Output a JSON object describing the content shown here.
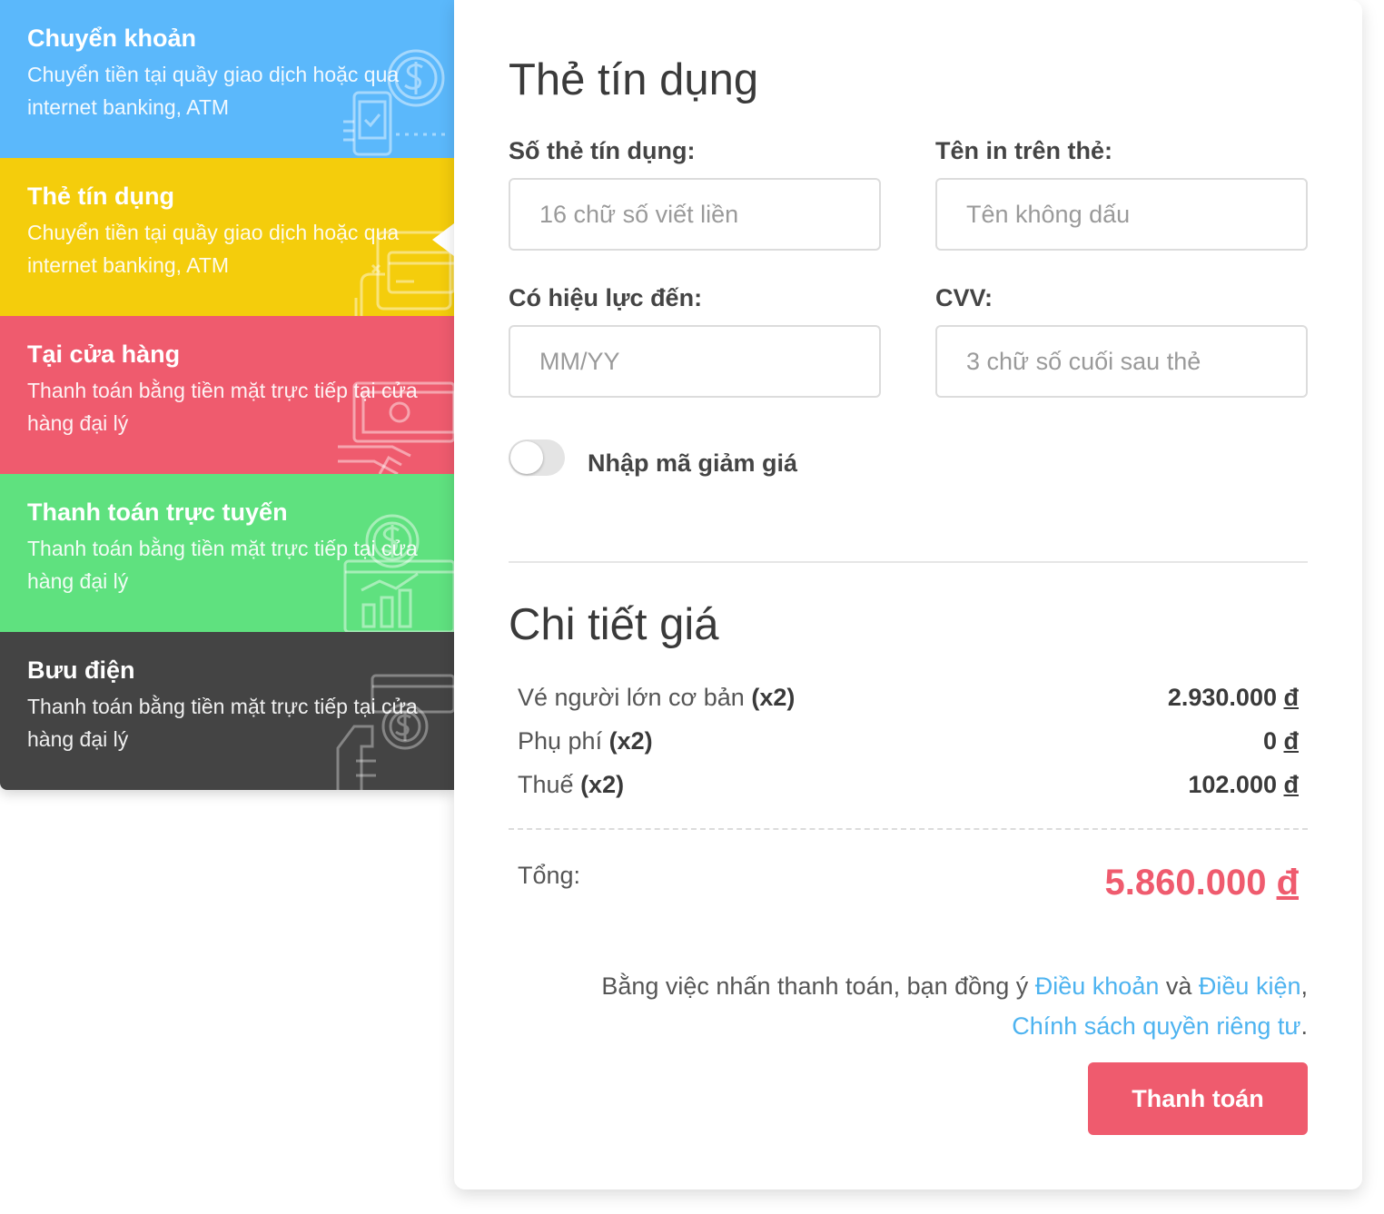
{
  "methods": [
    {
      "title": "Chuyển khoản",
      "desc": "Chuyển tiền tại quầy giao dịch hoặc qua internet banking, ATM",
      "color": "#5bb8fb",
      "icon": "mobile-banking-icon"
    },
    {
      "title": "Thẻ tín dụng",
      "desc": "Chuyển tiền tại quầy giao dịch hoặc qua internet banking, ATM",
      "color": "#f4cd0c",
      "icon": "credit-card-icon",
      "active": true
    },
    {
      "title": "Tại cửa hàng",
      "desc": "Thanh toán bằng tiền mặt trực tiếp tại cửa hàng đại lý",
      "color": "#ef5b6e",
      "icon": "cash-hand-icon"
    },
    {
      "title": "Thanh toán trực tuyến",
      "desc": "Thanh toán bằng tiền mặt trực tiếp tại cửa hàng đại lý",
      "color": "#5fe17f",
      "icon": "online-payment-chart-icon"
    },
    {
      "title": "Bưu điện",
      "desc": "Thanh toán bằng tiền mặt trực tiếp tại cửa hàng đại lý",
      "color": "#444444",
      "icon": "money-wallet-icon"
    }
  ],
  "form": {
    "title": "Thẻ tín dụng",
    "card_number": {
      "label": "Số thẻ tín dụng:",
      "placeholder": "16 chữ số viết liền",
      "value": ""
    },
    "card_name": {
      "label": "Tên in trên thẻ:",
      "placeholder": "Tên không dấu",
      "value": ""
    },
    "expiry": {
      "label": "Có hiệu lực đến:",
      "placeholder": "MM/YY",
      "value": ""
    },
    "cvv": {
      "label": "CVV:",
      "placeholder": "3 chữ số cuối sau thẻ",
      "value": ""
    },
    "discount_toggle": {
      "label": "Nhập mã giảm giá",
      "on": false
    }
  },
  "price": {
    "title": "Chi tiết giá",
    "rows": [
      {
        "label": "Vé người lớn cơ bản",
        "qty": "(x2)",
        "amount": "2.930.000",
        "currency": "đ"
      },
      {
        "label": "Phụ phí",
        "qty": "(x2)",
        "amount": "0",
        "currency": "đ"
      },
      {
        "label": "Thuế",
        "qty": "(x2)",
        "amount": "102.000",
        "currency": "đ"
      }
    ],
    "total_label": "Tổng:",
    "total_amount": "5.860.000",
    "total_currency": "đ"
  },
  "terms": {
    "prefix": "Bằng việc nhấn thanh toán, bạn đồng ý",
    "link1": "Điều khoản",
    "and": "và",
    "link2": "Điều kiện",
    "comma": ",",
    "link3": "Chính sách quyền riêng tư",
    "suffix": "."
  },
  "pay_button": "Thanh toán",
  "accent_color": "#ef5b6e",
  "link_color": "#4db3f0"
}
